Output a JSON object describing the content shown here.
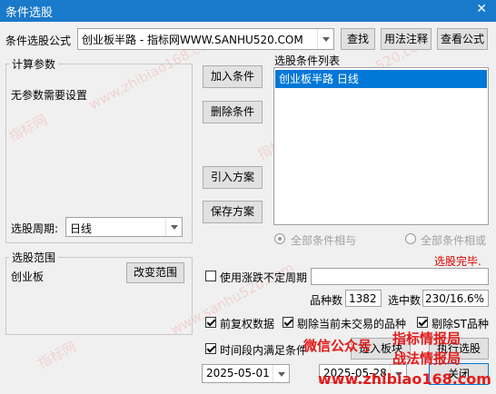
{
  "window": {
    "title": "条件选股",
    "close_glyph": "✕"
  },
  "formula": {
    "label": "条件选股公式",
    "value": "创业板半路   - 指标网WWW.SANHU520.COM"
  },
  "buttons": {
    "find": "查找",
    "usage": "用法注释",
    "view": "查看公式",
    "add_condition": "加入条件",
    "delete_condition": "删除条件",
    "import_plan": "引入方案",
    "save_plan": "保存方案",
    "change_range": "改变范围",
    "add_block": "选入板块",
    "execute": "执行选股",
    "close": "关闭"
  },
  "calc_params": {
    "legend": "计算参数",
    "text": "无参数需要设置"
  },
  "period": {
    "label": "选股周期:",
    "value": "日线"
  },
  "condition_list": {
    "legend": "选股条件列表",
    "items": [
      "创业板半路  日线"
    ]
  },
  "logic": {
    "and_label": "全部条件相与",
    "or_label": "全部条件相或"
  },
  "status": {
    "text": "选股完毕.",
    "color": "#e00000"
  },
  "range": {
    "legend": "选股范围",
    "value": "创业板"
  },
  "uncertain_period": {
    "label": "使用涨跌不定周期"
  },
  "counts": {
    "stock_count_label": "品种数",
    "stock_count": "1382",
    "selected_label": "选中数",
    "selected": "230/16.6%"
  },
  "options": {
    "adjusted": "前复权数据",
    "remove_untraded": "剔除当前未交易的品种",
    "remove_st": "剔除ST品种",
    "period_condition": "时间段内满足条件"
  },
  "dates": {
    "start": "2025-05-01",
    "end": "2025-05-28"
  },
  "watermarks": {
    "w1": "www.zhibiao168.com",
    "w2": "指标网",
    "w3": "www.sanhu520.com",
    "w4": "指标网",
    "overlay1": "微信公众号",
    "overlay2": "指标情报局",
    "overlay3": "战法情报局",
    "overlay4": "www.zhibiao168.com"
  }
}
